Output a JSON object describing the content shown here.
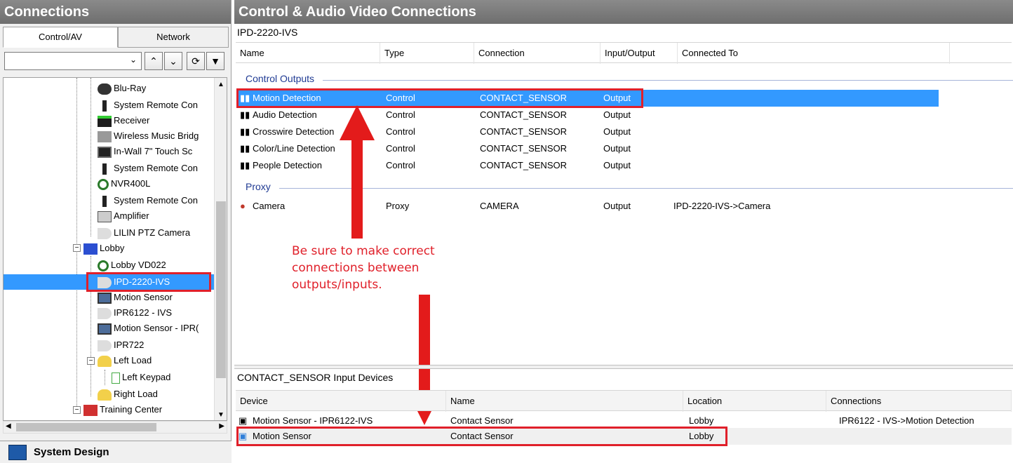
{
  "left_panel": {
    "title": "Connections",
    "tabs": [
      {
        "label": "Control/AV"
      },
      {
        "label": "Network"
      }
    ],
    "tree": [
      {
        "label": "Blu-Ray",
        "icon": "bluray-icon"
      },
      {
        "label": "System Remote Con",
        "icon": "remote-icon"
      },
      {
        "label": "Receiver",
        "icon": "receiver-icon"
      },
      {
        "label": "Wireless Music Bridg",
        "icon": "music-bridge-icon"
      },
      {
        "label": "In-Wall 7\" Touch Sc",
        "icon": "touchscreen-icon"
      },
      {
        "label": "System Remote Con",
        "icon": "remote-icon"
      },
      {
        "label": "NVR400L",
        "icon": "nvr-icon"
      },
      {
        "label": "System Remote Con",
        "icon": "remote-icon"
      },
      {
        "label": "Amplifier",
        "icon": "amplifier-icon"
      },
      {
        "label": "LILIN PTZ Camera",
        "icon": "camera-icon"
      },
      {
        "label": "Lobby",
        "icon": "room-icon"
      },
      {
        "label": "Lobby VD022",
        "icon": "nvr-icon"
      },
      {
        "label": "IPD-2220-IVS",
        "icon": "camera-icon"
      },
      {
        "label": "Motion Sensor",
        "icon": "sensor-icon"
      },
      {
        "label": "IPR6122 - IVS",
        "icon": "camera-icon"
      },
      {
        "label": "Motion Sensor - IPR(",
        "icon": "sensor-icon"
      },
      {
        "label": "IPR722",
        "icon": "camera-icon"
      },
      {
        "label": "Left Load",
        "icon": "load-icon"
      },
      {
        "label": "Left Keypad",
        "icon": "keypad-icon"
      },
      {
        "label": "Right Load",
        "icon": "load-icon"
      },
      {
        "label": "Training Center",
        "icon": "room-icon"
      }
    ],
    "footer": "System Design"
  },
  "right_panel": {
    "title": "Control & Audio Video Connections",
    "device": "IPD-2220-IVS",
    "columns": [
      "Name",
      "Type",
      "Connection",
      "Input/Output",
      "Connected To"
    ],
    "groups": [
      {
        "label": "Control Outputs",
        "rows": [
          {
            "name": "Motion Detection",
            "type": "Control",
            "connection": "CONTACT_SENSOR",
            "io": "Output",
            "connected_to": ""
          },
          {
            "name": "Audio Detection",
            "type": "Control",
            "connection": "CONTACT_SENSOR",
            "io": "Output",
            "connected_to": ""
          },
          {
            "name": "Crosswire Detection",
            "type": "Control",
            "connection": "CONTACT_SENSOR",
            "io": "Output",
            "connected_to": ""
          },
          {
            "name": "Color/Line Detection",
            "type": "Control",
            "connection": "CONTACT_SENSOR",
            "io": "Output",
            "connected_to": ""
          },
          {
            "name": "People Detection",
            "type": "Control",
            "connection": "CONTACT_SENSOR",
            "io": "Output",
            "connected_to": ""
          }
        ]
      },
      {
        "label": "Proxy",
        "rows": [
          {
            "name": "Camera",
            "type": "Proxy",
            "connection": "CAMERA",
            "io": "Output",
            "connected_to": "IPD-2220-IVS->Camera"
          }
        ]
      }
    ],
    "note_lines": [
      "Be sure to make correct",
      "connections between",
      "outputs/inputs."
    ],
    "input_devices": {
      "title": "CONTACT_SENSOR Input Devices",
      "columns": [
        "Device",
        "Name",
        "Location",
        "Connections"
      ],
      "rows": [
        {
          "device": "Motion Sensor - IPR6122-IVS",
          "name": "Contact Sensor",
          "location": "Lobby",
          "connections": "IPR6122 - IVS->Motion Detection"
        },
        {
          "device": "Motion Sensor",
          "name": "Contact Sensor",
          "location": "Lobby",
          "connections": ""
        }
      ]
    }
  },
  "colors": {
    "selection": "#3399ff",
    "annotation": "#e0202a",
    "header": "#7a7a7a"
  }
}
